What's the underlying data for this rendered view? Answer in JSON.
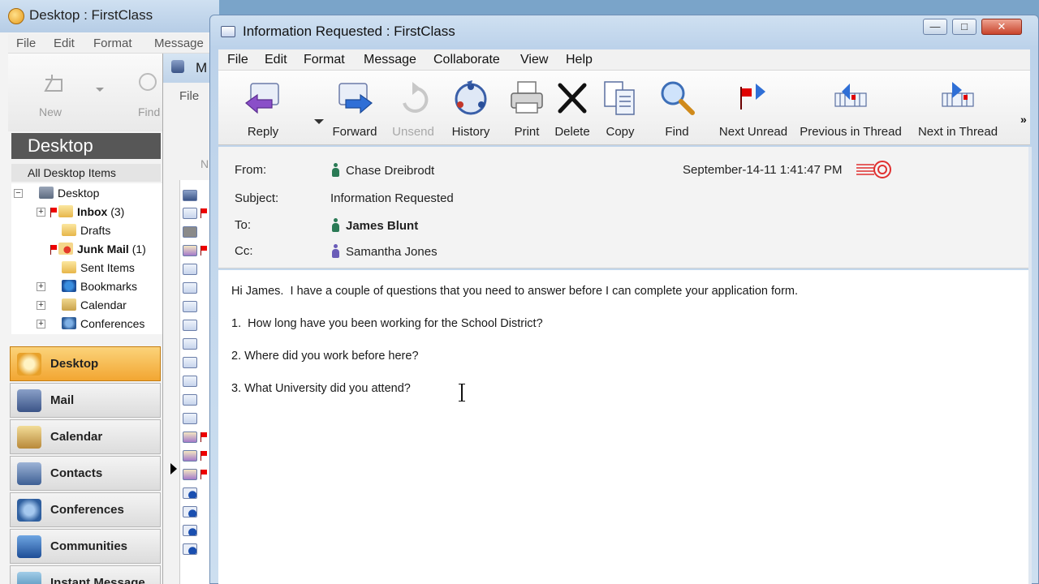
{
  "bg_window": {
    "title": "Desktop : FirstClass",
    "menu": [
      "File",
      "Edit",
      "Format",
      "Message"
    ],
    "toolbar": {
      "new_label": "New",
      "find_label": "Find"
    },
    "desktop_header": "Desktop",
    "all_items": "All Desktop Items",
    "tree": [
      {
        "label": "Desktop",
        "count": ""
      },
      {
        "label": "Inbox",
        "count": "(3)"
      },
      {
        "label": "Drafts",
        "count": ""
      },
      {
        "label": "Junk Mail",
        "count": "(1)"
      },
      {
        "label": "Sent Items",
        "count": ""
      },
      {
        "label": "Bookmarks",
        "count": ""
      },
      {
        "label": "Calendar",
        "count": ""
      },
      {
        "label": "Conferences",
        "count": ""
      }
    ],
    "nav": [
      "Desktop",
      "Mail",
      "Calendar",
      "Contacts",
      "Conferences",
      "Communities",
      "Instant Message"
    ]
  },
  "mid_window": {
    "title_fragment": "M",
    "menu_fragment": "File",
    "new_fragment": "N"
  },
  "window": {
    "title": "Information Requested : FirstClass",
    "controls": {
      "minimize": "—",
      "maximize": "□",
      "close": "✕"
    }
  },
  "menu": [
    "File",
    "Edit",
    "Format",
    "Message",
    "Collaborate",
    "View",
    "Help"
  ],
  "toolbar": [
    {
      "label": "Reply",
      "icon": "reply-icon"
    },
    {
      "label": "Forward",
      "icon": "forward-icon"
    },
    {
      "label": "Unsend",
      "icon": "unsend-icon"
    },
    {
      "label": "History",
      "icon": "history-icon"
    },
    {
      "label": "Print",
      "icon": "printer-icon"
    },
    {
      "label": "Delete",
      "icon": "delete-x-icon"
    },
    {
      "label": "Copy",
      "icon": "copy-icon"
    },
    {
      "label": "Find",
      "icon": "magnifier-icon"
    },
    {
      "label": "Next Unread",
      "icon": "next-unread-flag-icon"
    },
    {
      "label": "Previous in Thread",
      "icon": "previous-thread-icon"
    },
    {
      "label": "Next in Thread",
      "icon": "next-thread-icon"
    }
  ],
  "overflow": "»",
  "message": {
    "from_label": "From:",
    "from": "Chase Dreibrodt",
    "date": "September-14-11 1:41:47 PM",
    "subject_label": "Subject:",
    "subject": "Information Requested",
    "to_label": "To:",
    "to": "James Blunt",
    "cc_label": "Cc:",
    "cc": "Samantha Jones",
    "body": [
      "Hi James.  I have a couple of questions that you need to answer before I can complete your application form.",
      "1.  How long have you been working for the School District?",
      "2. Where did you work before here?",
      "3. What University did you attend?"
    ]
  },
  "colors": {
    "titlebar": "#bcd2ea",
    "active_nav": "#f2a632",
    "accent_flag": "#e00000",
    "reply_purple": "#8a4fc8",
    "forward_blue": "#2f6fd6"
  }
}
